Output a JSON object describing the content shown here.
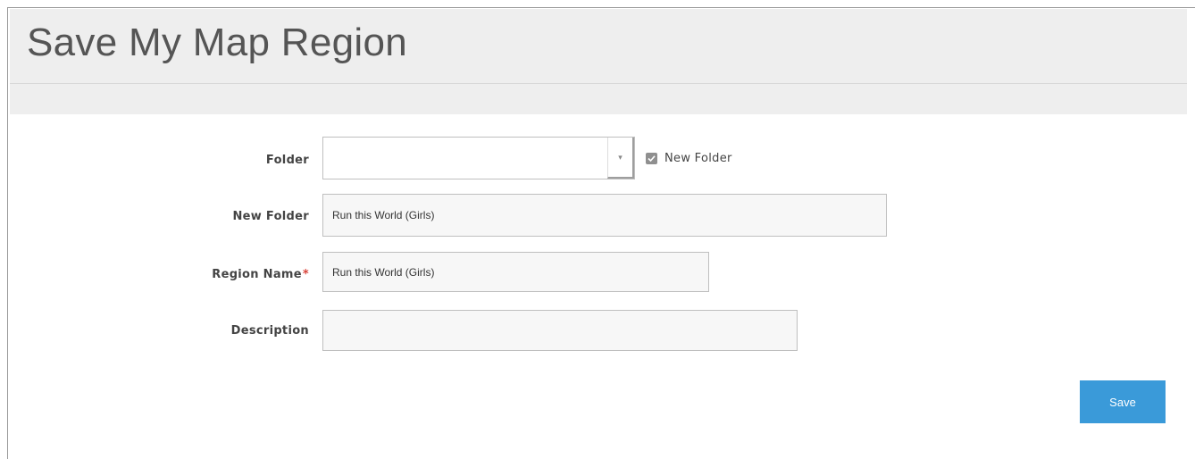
{
  "page": {
    "title": "Save My Map Region"
  },
  "form": {
    "folder": {
      "label": "Folder",
      "selected_value": "",
      "arrow_glyph": "▾",
      "new_folder_checkbox": {
        "label": "New Folder",
        "checked": true
      }
    },
    "new_folder": {
      "label": "New Folder",
      "value": "Run this World (Girls)"
    },
    "region_name": {
      "label": "Region Name",
      "required_marker": "*",
      "value": "Run this World (Girls)"
    },
    "description": {
      "label": "Description",
      "value": ""
    },
    "save_label": "Save"
  },
  "colors": {
    "accent": "#3a9ad9",
    "required": "#d9443b",
    "header_bg": "#eeeeee"
  },
  "icons": {
    "dropdown": "chevron-down-icon",
    "checkbox": "checkmark-icon"
  }
}
